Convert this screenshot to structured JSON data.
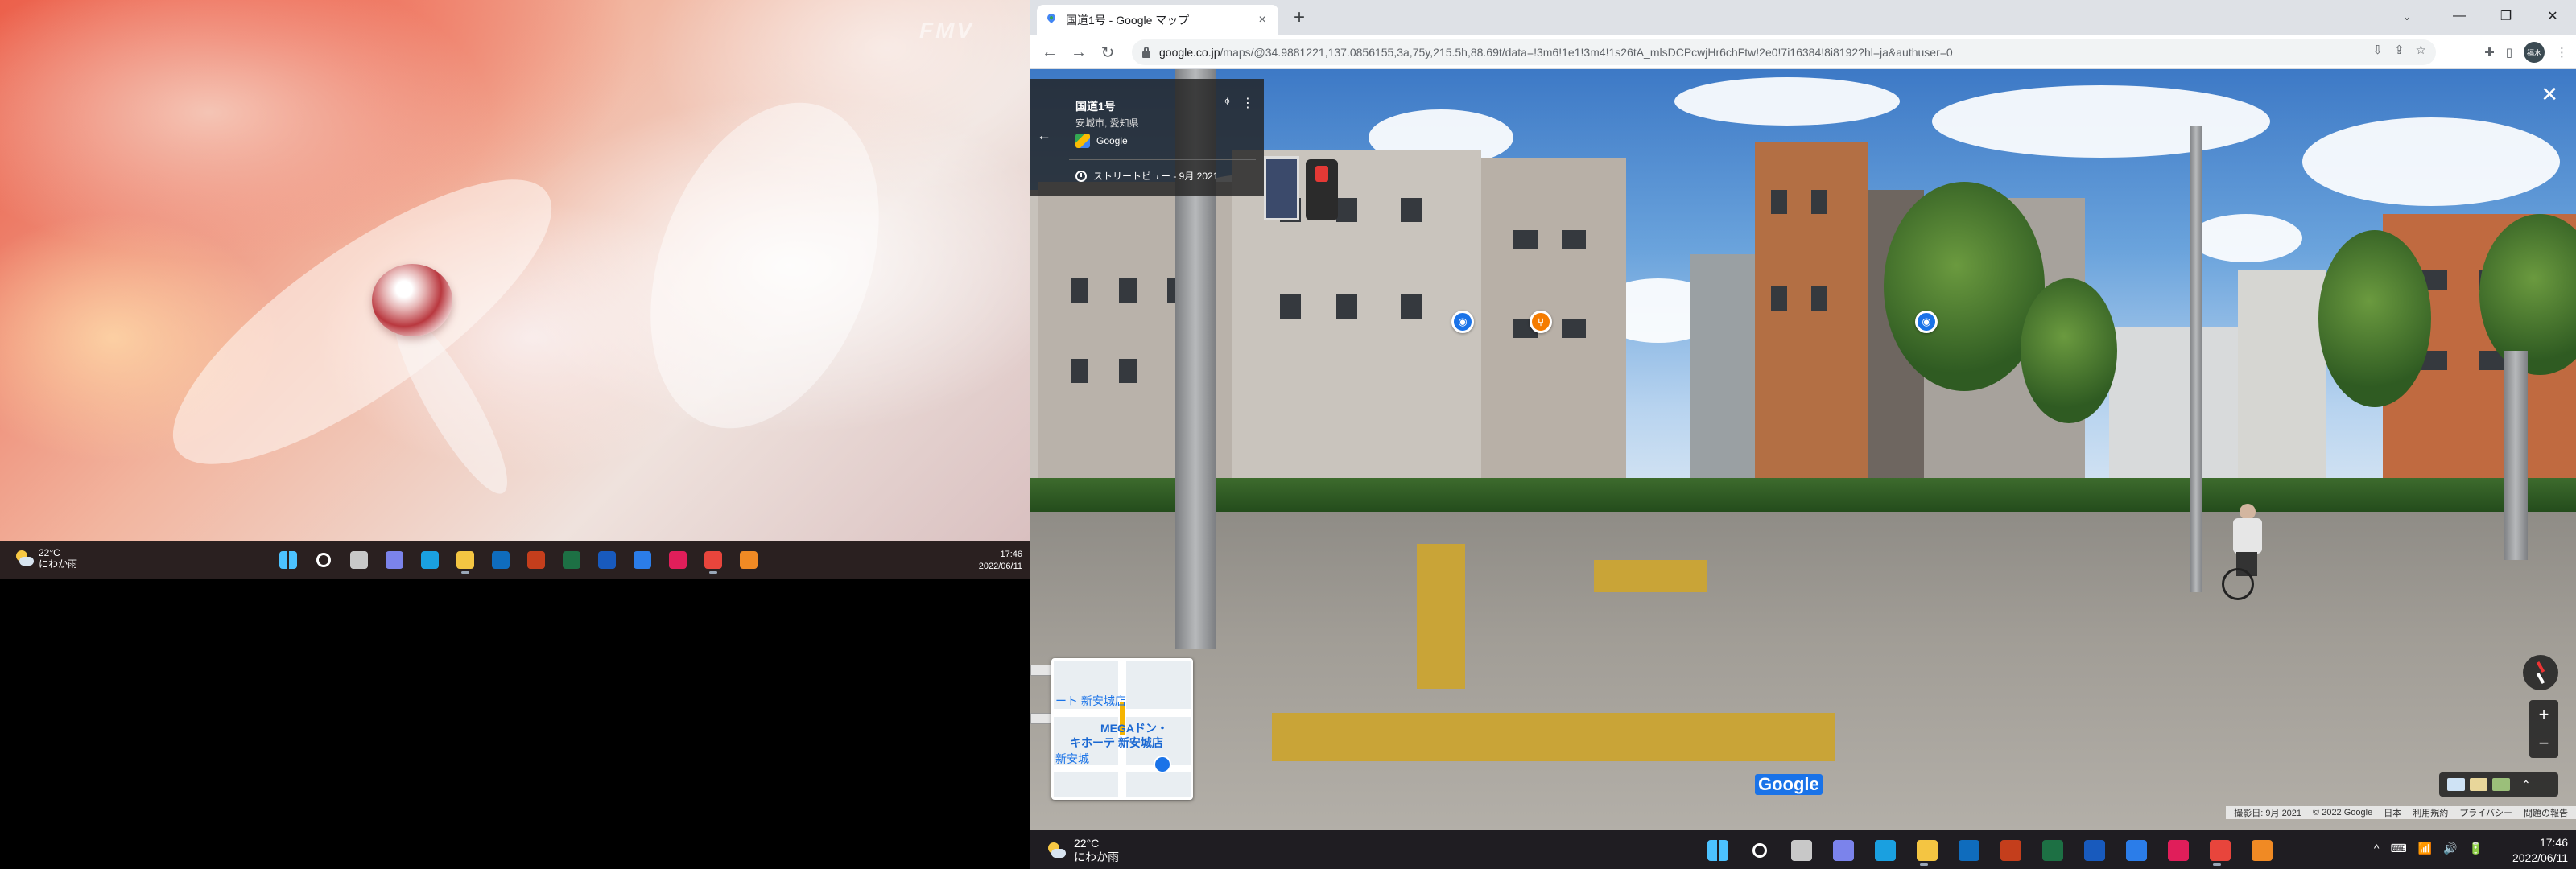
{
  "left_monitor": {
    "watermark": "FMV",
    "taskbar": {
      "weather": {
        "temp": "22°C",
        "condition": "にわか雨"
      },
      "clock": {
        "time": "17:46",
        "date": "2022/06/11"
      },
      "apps": [
        {
          "name": "start-icon",
          "color": "#4cc2ff"
        },
        {
          "name": "search-icon",
          "color": "#ffffff"
        },
        {
          "name": "task-view-icon",
          "color": "#c8c8c8"
        },
        {
          "name": "chat-icon",
          "color": "#7b83eb"
        },
        {
          "name": "edge-icon",
          "color": "#1aa0e0"
        },
        {
          "name": "file-explorer-icon",
          "color": "#f4c542"
        },
        {
          "name": "outlook-icon",
          "color": "#0f6cbd"
        },
        {
          "name": "powerpoint-icon",
          "color": "#c43e1c"
        },
        {
          "name": "excel-icon",
          "color": "#1d7044"
        },
        {
          "name": "word-icon",
          "color": "#185abd"
        },
        {
          "name": "maps-icon",
          "color": "#2b7de9"
        },
        {
          "name": "slack-icon",
          "color": "#e01e5a"
        },
        {
          "name": "chrome-icon",
          "color": "#e8453c"
        },
        {
          "name": "blender-icon",
          "color": "#f08a24"
        }
      ]
    }
  },
  "browser": {
    "tab": {
      "title": "国道1号 - Google マップ",
      "close": "×"
    },
    "new_tab": "+",
    "window_controls": {
      "minimize": "—",
      "restore": "❐",
      "close": "✕"
    },
    "tab_search": "⌄",
    "nav": {
      "back": "←",
      "forward": "→",
      "reload": "↻"
    },
    "url": {
      "host": "google.co.jp",
      "path": "/maps/@34.9881221,137.0856155,3a,75y,215.5h,88.69t/data=!3m6!1e1!3m4!1s26tA_mlsDCPcwjHr6chFtw!2e0!7i16384!8i8192?hl=ja&authuser=0"
    },
    "avatar_text": "福水"
  },
  "street_view": {
    "card": {
      "title": "国道1号",
      "subtitle": "安城市, 愛知県",
      "provider": "Google",
      "date_label": "ストリートビュー - 9月 2021"
    },
    "close": "✕",
    "zoom": {
      "in": "+",
      "out": "−"
    },
    "minimap": {
      "label_1": "ート 新安城店",
      "label_2": "MEGAドン・",
      "label_3": "キホーテ 新安城店",
      "label_4": "新安城"
    },
    "watermark": "Google",
    "footer": [
      "撮影日: 9月 2021",
      "© 2022 Google",
      "日本",
      "利用規約",
      "プライバシー",
      "問題の報告"
    ]
  },
  "right_taskbar": {
    "weather": {
      "temp": "22°C",
      "condition": "にわか雨"
    },
    "clock": {
      "time": "17:46",
      "date": "2022/06/11"
    },
    "tray": [
      "^",
      "⌨",
      "📶",
      "🔊",
      "🔋"
    ]
  }
}
